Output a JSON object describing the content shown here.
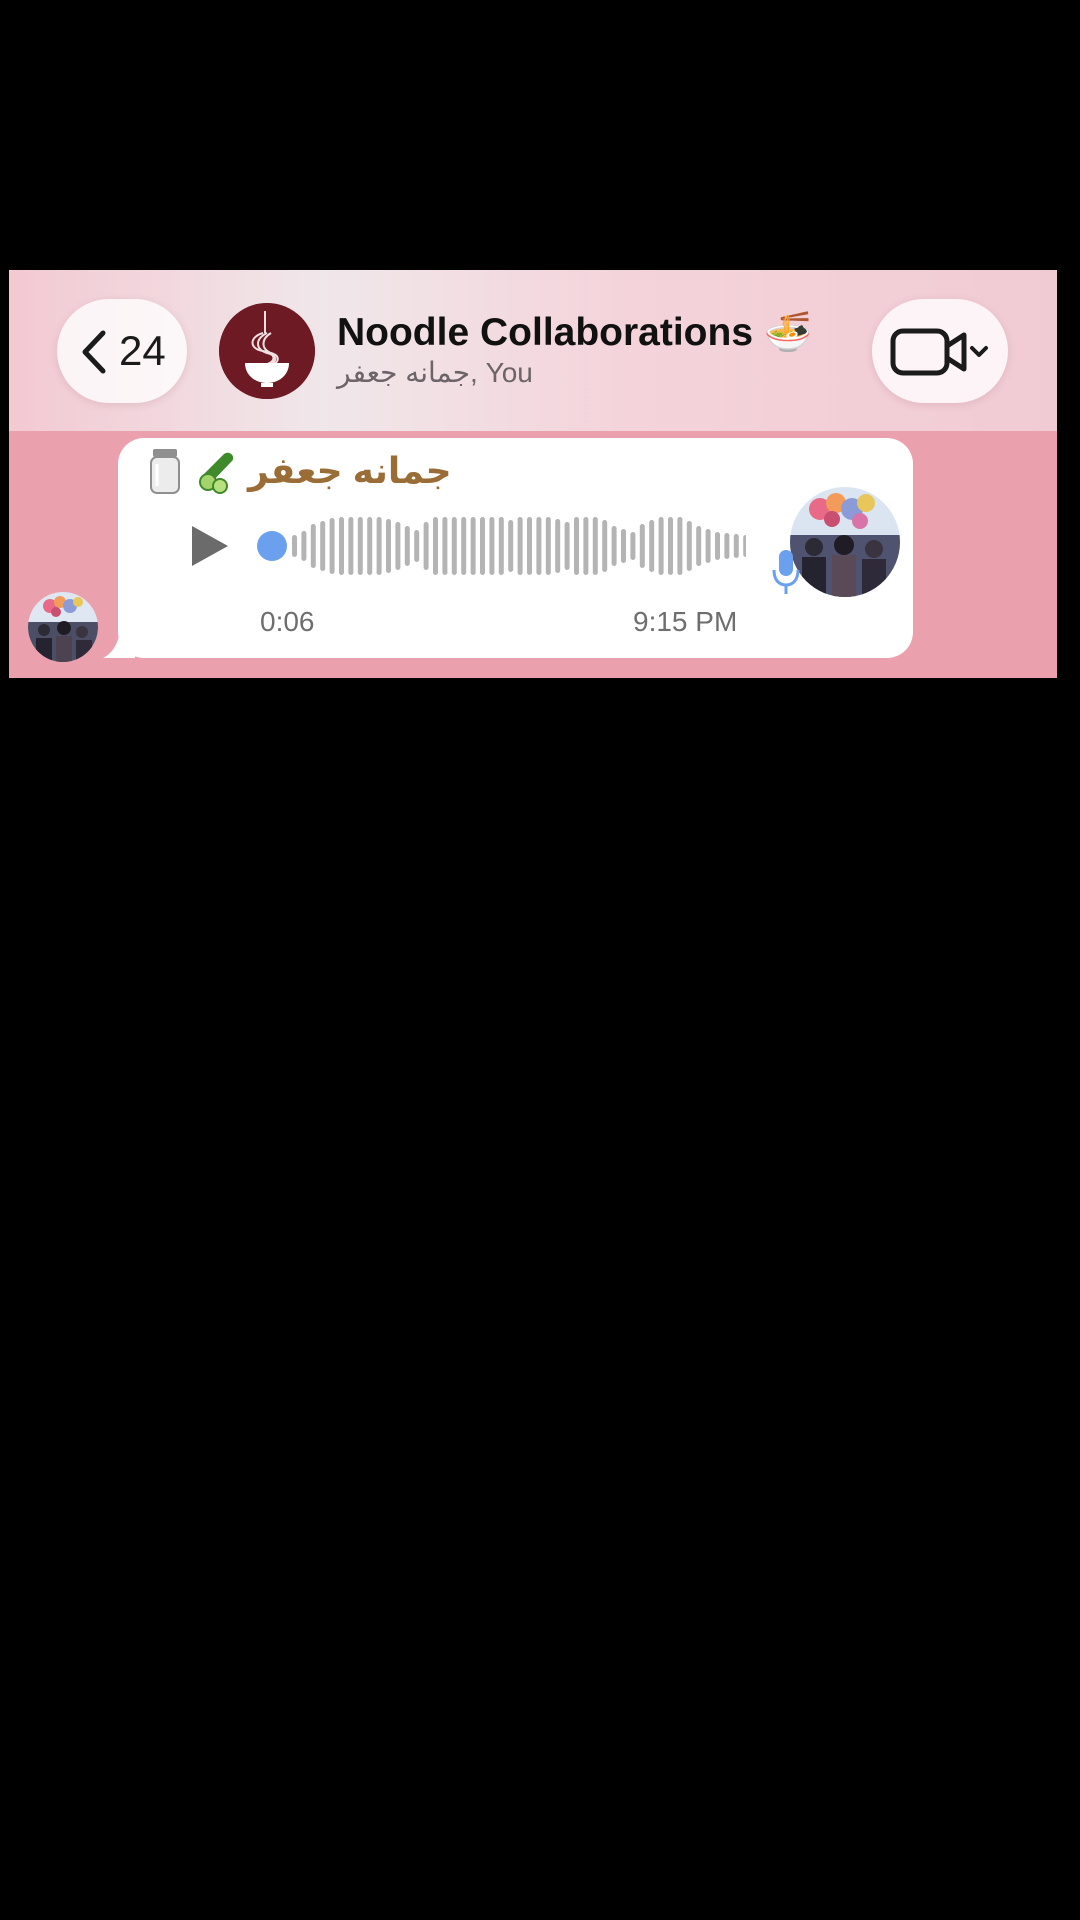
{
  "header": {
    "back_count": "24",
    "title": "Noodle Collaborations 🍜",
    "subtitle": "جمانه جعفر, You",
    "icons": {
      "back": "chevron-left-icon",
      "group_avatar": "noodle-bowl-logo",
      "call": "video-camera-icon",
      "call_menu": "chevron-down-icon"
    }
  },
  "message": {
    "sender_name": "جمانه جعفر",
    "sender_emoji": [
      "jar-icon",
      "cucumber-icon"
    ],
    "voice_note": {
      "duration": "0:06",
      "progress": 0
    },
    "time": "9:15 PM"
  },
  "colors": {
    "accent": "#6aa0ee",
    "sender_name": "#9a6c36",
    "chat_background": "#eaa1ad",
    "group_avatar_bg": "#6e1a25"
  }
}
